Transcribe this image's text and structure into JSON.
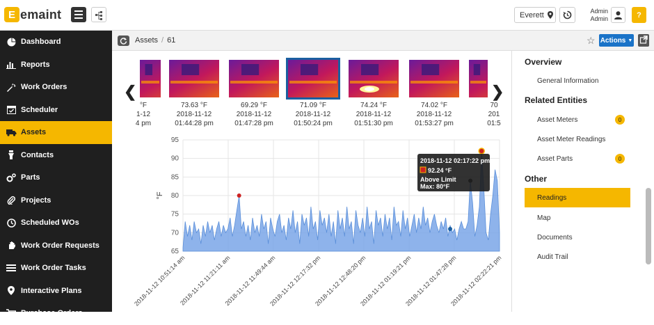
{
  "app": {
    "logo_mark": "E",
    "logo_text": "emaint"
  },
  "topbar": {
    "location": "Everett",
    "user_line1": "Admin",
    "user_line2": "Admin",
    "help": "?"
  },
  "sidebar": {
    "items": [
      {
        "label": "Dashboard",
        "icon": "pie-chart-icon"
      },
      {
        "label": "Reports",
        "icon": "bar-chart-icon"
      },
      {
        "label": "Work Orders",
        "icon": "wrench-icon"
      },
      {
        "label": "Scheduler",
        "icon": "calendar-icon"
      },
      {
        "label": "Assets",
        "icon": "truck-icon",
        "active": true
      },
      {
        "label": "Contacts",
        "icon": "person-icon"
      },
      {
        "label": "Parts",
        "icon": "gears-icon"
      },
      {
        "label": "Projects",
        "icon": "paperclip-icon"
      },
      {
        "label": "Scheduled WOs",
        "icon": "clock-icon"
      },
      {
        "label": "Work Order Requests",
        "icon": "hand-icon"
      },
      {
        "label": "Work Order Tasks",
        "icon": "list-icon"
      },
      {
        "label": "Interactive Plans",
        "icon": "map-pin-icon"
      },
      {
        "label": "Purchase Orders",
        "icon": "cart-icon"
      }
    ]
  },
  "breadcrumb": {
    "section": "Assets",
    "id": "61"
  },
  "toolbar": {
    "actions_label": "Actions"
  },
  "gallery": {
    "thumbs": [
      {
        "temp": "°F",
        "date": "1-12",
        "time": "4 pm"
      },
      {
        "temp": "73.63 °F",
        "date": "2018-11-12",
        "time": "01:44:28 pm"
      },
      {
        "temp": "69.29 °F",
        "date": "2018-11-12",
        "time": "01:47:28 pm"
      },
      {
        "temp": "71.09 °F",
        "date": "2018-11-12",
        "time": "01:50:24 pm",
        "selected": true
      },
      {
        "temp": "74.24 °F",
        "date": "2018-11-12",
        "time": "01:51:30 pm"
      },
      {
        "temp": "74.02 °F",
        "date": "2018-11-12",
        "time": "01:53:27 pm"
      },
      {
        "temp": "70",
        "date": "201",
        "time": "01:5"
      }
    ]
  },
  "chart_data": {
    "type": "area",
    "ylabel": "°F",
    "ylim": [
      65,
      95
    ],
    "yticks": [
      65,
      70,
      75,
      80,
      85,
      90,
      95
    ],
    "xticks": [
      "2018-11-12 10:51:14 am",
      "2018-11-12 11:21:11 am",
      "2018-11-12 11:49:44 am",
      "2018-11-12 12:17:32 pm",
      "2018-11-12 12:48:20 pm",
      "2018-11-12 01:19:21 pm",
      "2018-11-12 01:47:28 pm",
      "2018-11-12 02:22:21 pm"
    ],
    "series_color": "#7aa6e8",
    "values": [
      66,
      73,
      69,
      72,
      68,
      73,
      70,
      71,
      67,
      72,
      69,
      73,
      70,
      72,
      68,
      71,
      73,
      69,
      72,
      70,
      71,
      74,
      69,
      72,
      76,
      80,
      71,
      73,
      69,
      72,
      68,
      74,
      70,
      72,
      69,
      75,
      71,
      73,
      67,
      74,
      71,
      69,
      73,
      75,
      70,
      72,
      68,
      74,
      71,
      76,
      70,
      73,
      67,
      75,
      72,
      74,
      69,
      77,
      71,
      73,
      68,
      76,
      72,
      74,
      70,
      75,
      69,
      73,
      67,
      76,
      71,
      74,
      69,
      77,
      71,
      73,
      67,
      76,
      72,
      70,
      74,
      69,
      77,
      71,
      73,
      67,
      76,
      72,
      74,
      69,
      75,
      71,
      74,
      68,
      77,
      72,
      73,
      69,
      76,
      71,
      74,
      69,
      72,
      75,
      70,
      74,
      71,
      77,
      72,
      74,
      70,
      73,
      75,
      72,
      70,
      73,
      71,
      74,
      69,
      72,
      70,
      71,
      68,
      71,
      73,
      71,
      71,
      73,
      84,
      78,
      69,
      72,
      77,
      92,
      82,
      70,
      68,
      75,
      80,
      87,
      84,
      70
    ],
    "markers": [
      {
        "index": 25,
        "value": 80,
        "color": "#cc2222"
      },
      {
        "index": 119,
        "value": 71,
        "color": "#1a5fa0"
      },
      {
        "index": 128,
        "value": 84,
        "color": "#333333"
      },
      {
        "index": 133,
        "value": 92,
        "color": "#cc2222"
      }
    ],
    "tooltip": {
      "time": "2018-11-12 02:17:22 pm",
      "value": "92.24 °F",
      "status": "Above Limit",
      "max": "Max: 80°F"
    }
  },
  "rightpanel": {
    "overview_head": "Overview",
    "general_info": "General Information",
    "related_head": "Related Entities",
    "asset_meters": "Asset Meters",
    "asset_meters_count": "0",
    "asset_meter_readings": "Asset Meter Readings",
    "asset_parts": "Asset Parts",
    "asset_parts_count": "0",
    "other_head": "Other",
    "readings": "Readings",
    "map": "Map",
    "documents": "Documents",
    "audit_trail": "Audit Trail"
  }
}
